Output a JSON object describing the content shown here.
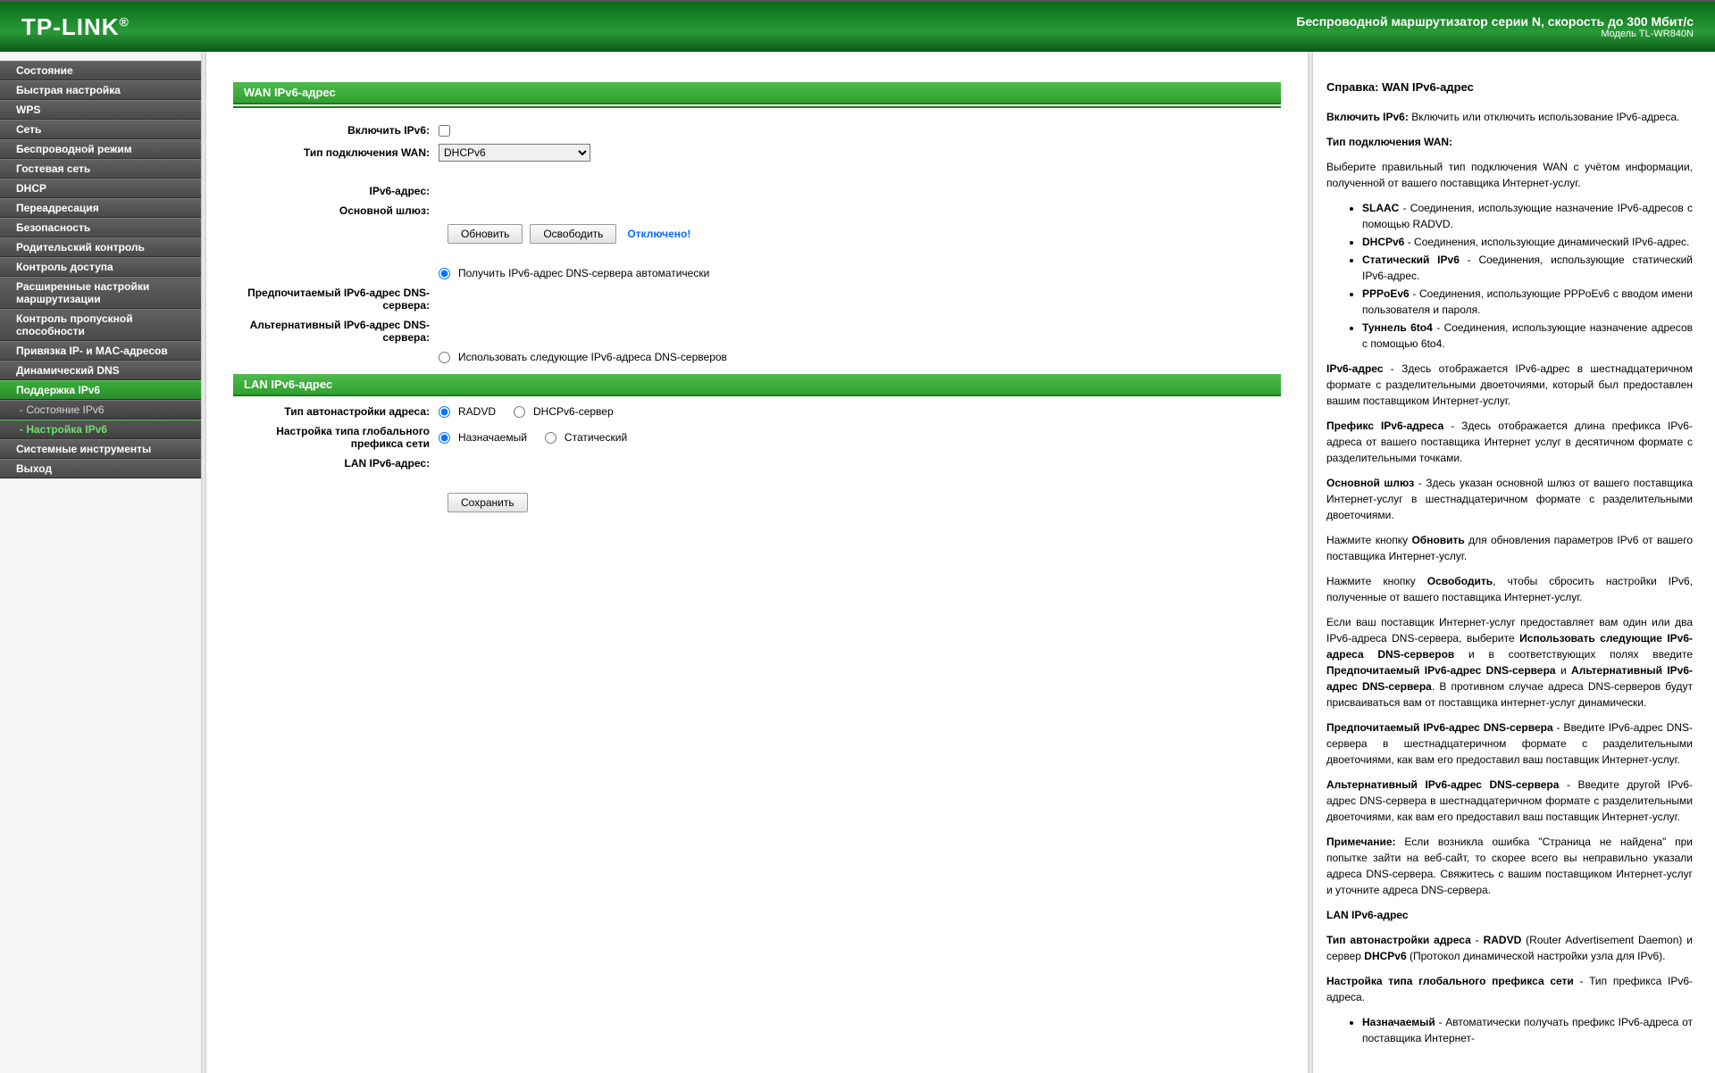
{
  "header": {
    "logo": "TP-LINK",
    "reg": "®",
    "title": "Беспроводной маршрутизатор серии N, скорость до 300 Мбит/с",
    "model": "Модель TL-WR840N"
  },
  "sidebar": {
    "items": [
      {
        "label": "Состояние"
      },
      {
        "label": "Быстрая настройка"
      },
      {
        "label": "WPS"
      },
      {
        "label": "Сеть"
      },
      {
        "label": "Беспроводной режим"
      },
      {
        "label": "Гостевая сеть"
      },
      {
        "label": "DHCP"
      },
      {
        "label": "Переадресация"
      },
      {
        "label": "Безопасность"
      },
      {
        "label": "Родительский контроль"
      },
      {
        "label": "Контроль доступа"
      },
      {
        "label": "Расширенные настройки маршрутизации"
      },
      {
        "label": "Контроль пропускной способности"
      },
      {
        "label": "Привязка IP- и MAC-адресов"
      },
      {
        "label": "Динамический DNS"
      },
      {
        "label": "Поддержка IPv6"
      },
      {
        "label": "- Состояние IPv6"
      },
      {
        "label": "- Настройка IPv6"
      },
      {
        "label": "Системные инструменты"
      },
      {
        "label": "Выход"
      }
    ]
  },
  "main": {
    "wan_section": "WAN IPv6-адрес",
    "lan_section": "LAN IPv6-адрес",
    "labels": {
      "enable_ipv6": "Включить IPv6:",
      "wan_conn_type": "Тип подключения WAN:",
      "ipv6_addr": "IPv6-адрес:",
      "gateway": "Основной шлюз:",
      "preferred_dns": "Предпочитаемый IPv6-адрес DNS-сервера:",
      "alternate_dns": "Альтернативный IPv6-адрес DNS-сервера:",
      "auto_addr_type": "Тип автонастройки адреса:",
      "global_prefix": "Настройка типа глобального префикса сети",
      "lan_ipv6_addr": "LAN IPv6-адрес:"
    },
    "wan_select": "DHCPv6",
    "btn_renew": "Обновить",
    "btn_release": "Освободить",
    "status": "Отключено!",
    "dns_auto": "Получить IPv6-адрес DNS-сервера автоматически",
    "dns_manual": "Использовать следующие IPv6-адреса DNS-серверов",
    "radvd": "RADVD",
    "dhcpv6_server": "DHCPv6-сервер",
    "assigned": "Назначаемый",
    "static": "Статический",
    "btn_save": "Сохранить"
  },
  "help": {
    "title": "Справка: WAN IPv6-адрес",
    "p1a": "Включить IPv6:",
    "p1b": " Включить или отключить использование IPv6-адреса.",
    "p2": "Тип подключения WAN:",
    "p3": "Выберите правильный тип подключения WAN с учётом информации, полученной от вашего поставщика Интернет-услуг.",
    "li": [
      {
        "b": "SLAAC",
        "t": " - Соединения, использующие назначение IPv6-адресов с помощью RADVD."
      },
      {
        "b": "DHCPv6",
        "t": " - Соединения, использующие динамический IPv6-адрес."
      },
      {
        "b": "Статический IPv6",
        "t": " - Соединения, использующие статический IPv6-адрес."
      },
      {
        "b": "PPPoEv6",
        "t": " - Соединения, использующие PPPoEv6 с вводом имени пользователя и пароля."
      },
      {
        "b": "Туннель 6to4",
        "t": " - Соединения, использующие назначение адресов с помощью 6to4."
      }
    ],
    "p4a": "IPv6-адрес",
    "p4b": " - Здесь отображается IPv6-адрес в шестнадцатеричном формате с разделительными двоеточиями, который был предоставлен вашим поставщиком Интернет-услуг.",
    "p5a": "Префикс IPv6-адреса",
    "p5b": " - Здесь отображается длина префикса IPv6-адреса от вашего поставщика Интернет услуг в десятичном формате с разделительными точками.",
    "p6a": "Основной шлюз",
    "p6b": " - Здесь указан основной шлюз от вашего поставщика Интернет-услуг в шестнадцатеричном формате с разделительными двоеточиями.",
    "p7a": "Нажмите кнопку ",
    "p7b": "Обновить",
    "p7c": " для обновления параметров IPv6 от вашего поставщика Интернет-услуг.",
    "p8a": "Нажмите кнопку ",
    "p8b": "Освободить",
    "p8c": ", чтобы сбросить настройки IPv6, полученные от вашего поставщика Интернет-услуг.",
    "p9a": "Если ваш поставщик Интернет-услуг предоставляет вам один или два IPv6-адреса DNS-сервера, выберите ",
    "p9b": "Использовать следующие IPv6-адреса DNS-серверов",
    "p9c": " и в соответствующих полях введите ",
    "p9d": "Предпочитаемый IPv6-адрес DNS-сервера",
    "p9e": " и ",
    "p9f": "Альтернативный IPv6-адрес DNS-сервера",
    "p9g": ". В противном случае адреса DNS-серверов будут присваиваться вам от поставщика интернет-услуг динамически.",
    "p10a": "Предпочитаемый IPv6-адрес DNS-сервера",
    "p10b": " - Введите IPv6-адрес DNS-сервера в шестнадцатеричном формате с разделительными двоеточиями, как вам его предоставил ваш поставщик Интернет-услуг.",
    "p11a": "Альтернативный IPv6-адрес DNS-сервера",
    "p11b": " - Введите другой IPv6-адрес DNS-сервера в шестнадцатеричном формате с разделительными двоеточиями, как вам его предоставил ваш поставщик Интернет-услуг.",
    "p12a": "Примечание:",
    "p12b": " Если возникла ошибка \"Страница не найдена\" при попытке зайти на веб-сайт, то скорее всего вы неправильно указали адреса DNS-сервера. Свяжитесь с вашим поставщиком Интернет-услуг и уточните адреса DNS-сервера.",
    "lan_head": "LAN IPv6-адрес",
    "p13a": "Тип автонастройки адреса",
    "p13b": " - ",
    "p13c": "RADVD",
    "p13d": " (Router Advertisement Daemon) и сервер ",
    "p13e": "DHCPv6",
    "p13f": " (Протокол динамической настройки узла для IPv6).",
    "p14a": "Настройка типа глобального префикса сети",
    "p14b": " - Тип префикса IPv6-адреса.",
    "p15a": "Назначаемый",
    "p15b": " - Автоматически получать префикс IPv6-адреса от поставщика Интернет-"
  }
}
